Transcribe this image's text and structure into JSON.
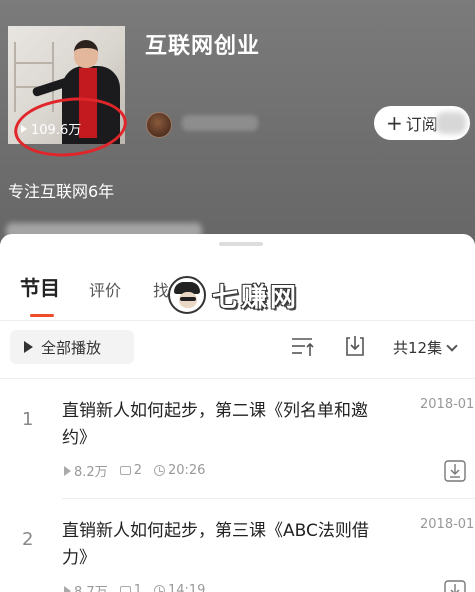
{
  "album": {
    "title": "互联网创业",
    "play_count": "109.6万",
    "subscribe_label": "订阅",
    "description": "专注互联网6年"
  },
  "tabs": [
    {
      "label": "节目",
      "active": true
    },
    {
      "label": "评价",
      "active": false
    },
    {
      "label": "找",
      "active": false
    }
  ],
  "watermark": {
    "text": "七赚网"
  },
  "toolbar": {
    "play_all_label": "全部播放",
    "count_label": "共12集"
  },
  "episodes": [
    {
      "index": "1",
      "title": "直销新人如何起步，第二课《列名单和邀约》",
      "date": "2018-01",
      "plays": "8.2万",
      "comments": "2",
      "duration": "20:26"
    },
    {
      "index": "2",
      "title": "直销新人如何起步，第三课《ABC法则借力》",
      "date": "2018-01",
      "plays": "8.7万",
      "comments": "1",
      "duration": "14:19"
    }
  ],
  "colors": {
    "accent": "#f04b2a",
    "highlight_circle": "#e0262a",
    "header_bg": "#717171"
  },
  "icons": [
    "play-icon",
    "sort-icon",
    "download-icon",
    "chevron-down-icon",
    "comment-icon",
    "clock-icon"
  ]
}
